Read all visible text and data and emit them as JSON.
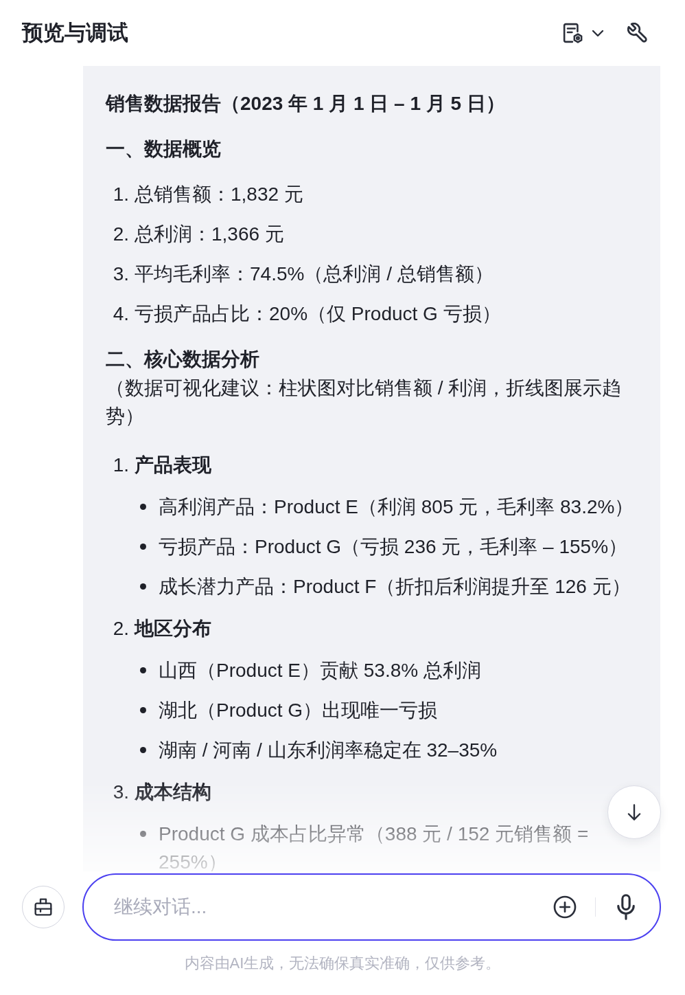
{
  "header": {
    "title": "预览与调试"
  },
  "report": {
    "title": "销售数据报告（2023 年 1 月 1 日 – 1 月 5 日）",
    "sections": [
      {
        "heading": "一、数据概览",
        "items": [
          {
            "number": "1.",
            "text": "总销售额：1,832 元"
          },
          {
            "number": "2.",
            "text": "总利润：1,366 元"
          },
          {
            "number": "3.",
            "text": "平均毛利率：74.5%（总利润 / 总销售额）"
          },
          {
            "number": "4.",
            "text": "亏损产品占比：20%（仅 Product G 亏损）"
          }
        ]
      },
      {
        "heading": "二、核心数据分析",
        "note": "（数据可视化建议：柱状图对比销售额 / 利润，折线图展示趋势）",
        "subsections": [
          {
            "number": "1.",
            "heading": "产品表现",
            "bullets": [
              "高利润产品：Product E（利润 805 元，毛利率 83.2%）",
              "亏损产品：Product G（亏损 236 元，毛利率 – 155%）",
              "成长潜力产品：Product F（折扣后利润提升至 126 元）"
            ]
          },
          {
            "number": "2.",
            "heading": "地区分布",
            "bullets": [
              "山西（Product E）贡献 53.8% 总利润",
              "湖北（Product G）出现唯一亏损",
              "湖南 / 河南 / 山东利润率稳定在 32–35%"
            ]
          },
          {
            "number": "3.",
            "heading": "成本结构",
            "bullets": [
              "Product G 成本占比异常（388 元 / 152 元销售额 = 255%）"
            ]
          }
        ]
      }
    ]
  },
  "composer": {
    "placeholder": "继续对话..."
  },
  "disclaimer": "内容由AI生成，无法确保真实准确，仅供参考。"
}
